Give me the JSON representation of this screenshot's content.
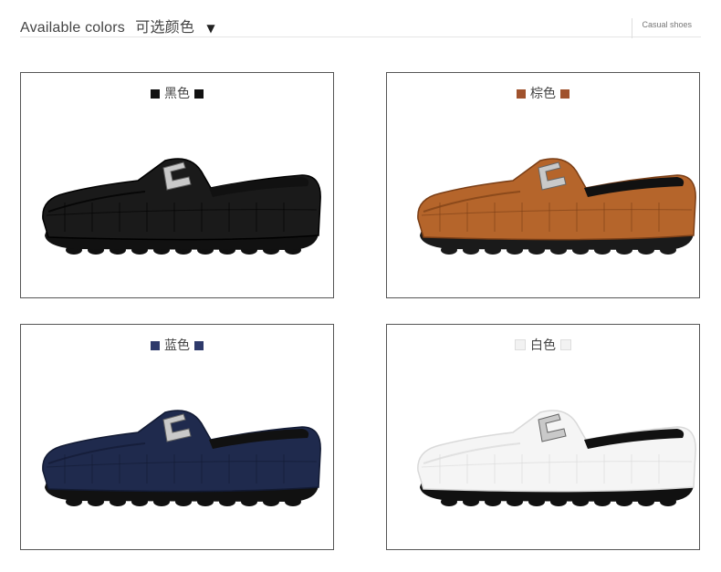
{
  "header": {
    "title_en": "Available colors",
    "title_zh": "可选颜色",
    "arrow": "▼",
    "tag": "Casual shoes"
  },
  "colors": [
    {
      "label": "黑色",
      "swatch": "#111111",
      "upper": "#1a1a1a",
      "shade": "#000000",
      "sole": "#111111"
    },
    {
      "label": "棕色",
      "swatch": "#a0522d",
      "upper": "#b5652b",
      "shade": "#7a3e16",
      "sole": "#1a1a1a"
    },
    {
      "label": "蓝色",
      "swatch": "#2e3a6b",
      "upper": "#1f2a4d",
      "shade": "#121a33",
      "sole": "#111111"
    },
    {
      "label": "白色",
      "swatch": "#f2f2f2",
      "upper": "#f5f5f5",
      "shade": "#d9d9d9",
      "sole": "#111111"
    }
  ]
}
